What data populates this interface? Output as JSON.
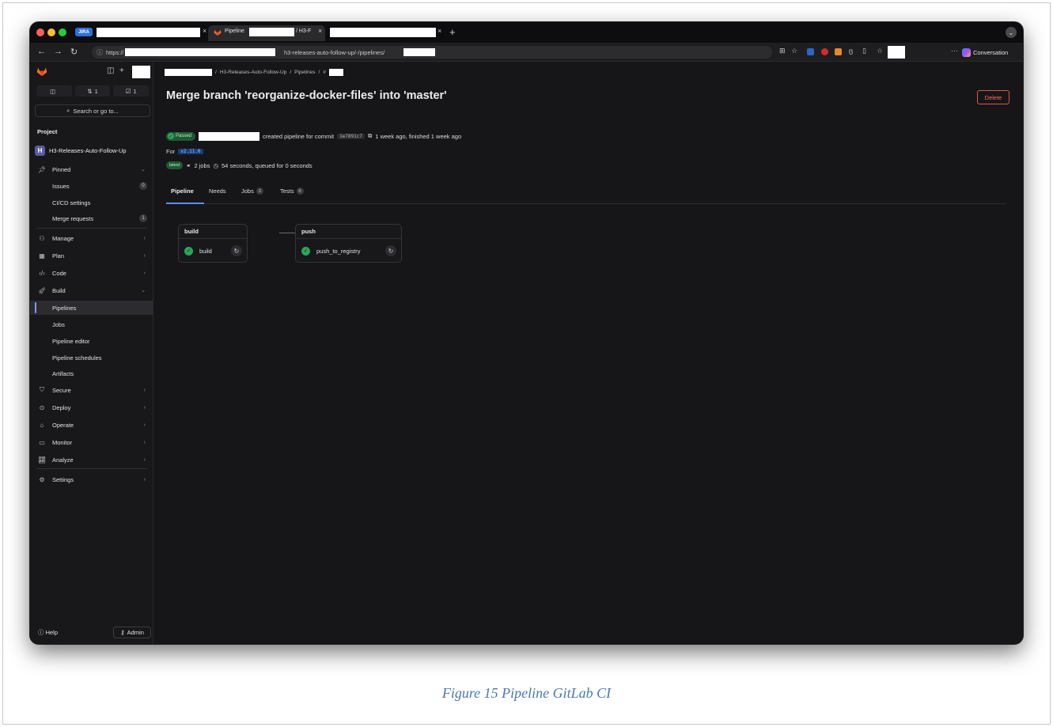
{
  "browser": {
    "tabs": [
      {
        "chip": "JIRA"
      },
      {
        "title": "Pipeline",
        "title_suffix": "/ H3-F"
      },
      {}
    ],
    "url_prefix": "https://",
    "url_tail": "h3-releases-auto-follow-up/-/pipelines/",
    "conversation_label": "Conversation",
    "accent_colors": {
      "close": "#ff5f57",
      "minimize": "#febc2e",
      "zoom": "#28c840"
    }
  },
  "sidebar": {
    "counters": [
      {
        "icon": "issues-icon",
        "value": ""
      },
      {
        "icon": "merge-request-icon",
        "value": "1"
      },
      {
        "icon": "todo-icon",
        "value": "1"
      }
    ],
    "search_label": "Search or go to...",
    "project_heading": "Project",
    "project_avatar": "H",
    "project_name": "H3-Releases-Auto-Follow-Up",
    "pinned_label": "Pinned",
    "pinned_items": [
      {
        "label": "Issues",
        "count": "0"
      },
      {
        "label": "CI/CD settings",
        "count": ""
      },
      {
        "label": "Merge requests",
        "count": "1"
      }
    ],
    "groups": [
      {
        "label": "Manage",
        "icon": "manage-icon"
      },
      {
        "label": "Plan",
        "icon": "plan-icon"
      },
      {
        "label": "Code",
        "icon": "code-icon"
      },
      {
        "label": "Build",
        "icon": "build-icon"
      }
    ],
    "build_items": [
      "Pipelines",
      "Jobs",
      "Pipeline editor",
      "Pipeline schedules",
      "Artifacts"
    ],
    "lower_groups": [
      {
        "label": "Secure",
        "icon": "secure-icon"
      },
      {
        "label": "Deploy",
        "icon": "deploy-icon"
      },
      {
        "label": "Operate",
        "icon": "operate-icon"
      },
      {
        "label": "Monitor",
        "icon": "monitor-icon"
      },
      {
        "label": "Analyze",
        "icon": "analyze-icon"
      }
    ],
    "settings_label": "Settings",
    "help_label": "Help",
    "admin_label": "Admin"
  },
  "main": {
    "breadcrumb": {
      "project": "H3-Releases-Auto-Follow-Up",
      "section": "Pipelines",
      "hash": "#"
    },
    "title": "Merge branch 'reorganize-docker-files' into 'master'",
    "delete_label": "Delete",
    "status_badge": "Passed",
    "created_text": "created pipeline for commit",
    "commit_sha": "1e7891c7",
    "timing_text": "1 week ago, finished 1 week ago",
    "for_label": "For",
    "ref": "v2.11.0",
    "latest_badge": "latest",
    "jobs_text": "2 jobs",
    "duration_text": "54 seconds, queued for 0 seconds",
    "tabs": [
      {
        "label": "Pipeline",
        "count": ""
      },
      {
        "label": "Needs",
        "count": ""
      },
      {
        "label": "Jobs",
        "count": "2"
      },
      {
        "label": "Tests",
        "count": "0"
      }
    ],
    "stages": [
      {
        "name": "build",
        "job": "build"
      },
      {
        "name": "push",
        "job": "push_to_registry"
      }
    ]
  },
  "caption": "Figure 15 Pipeline GitLab CI"
}
